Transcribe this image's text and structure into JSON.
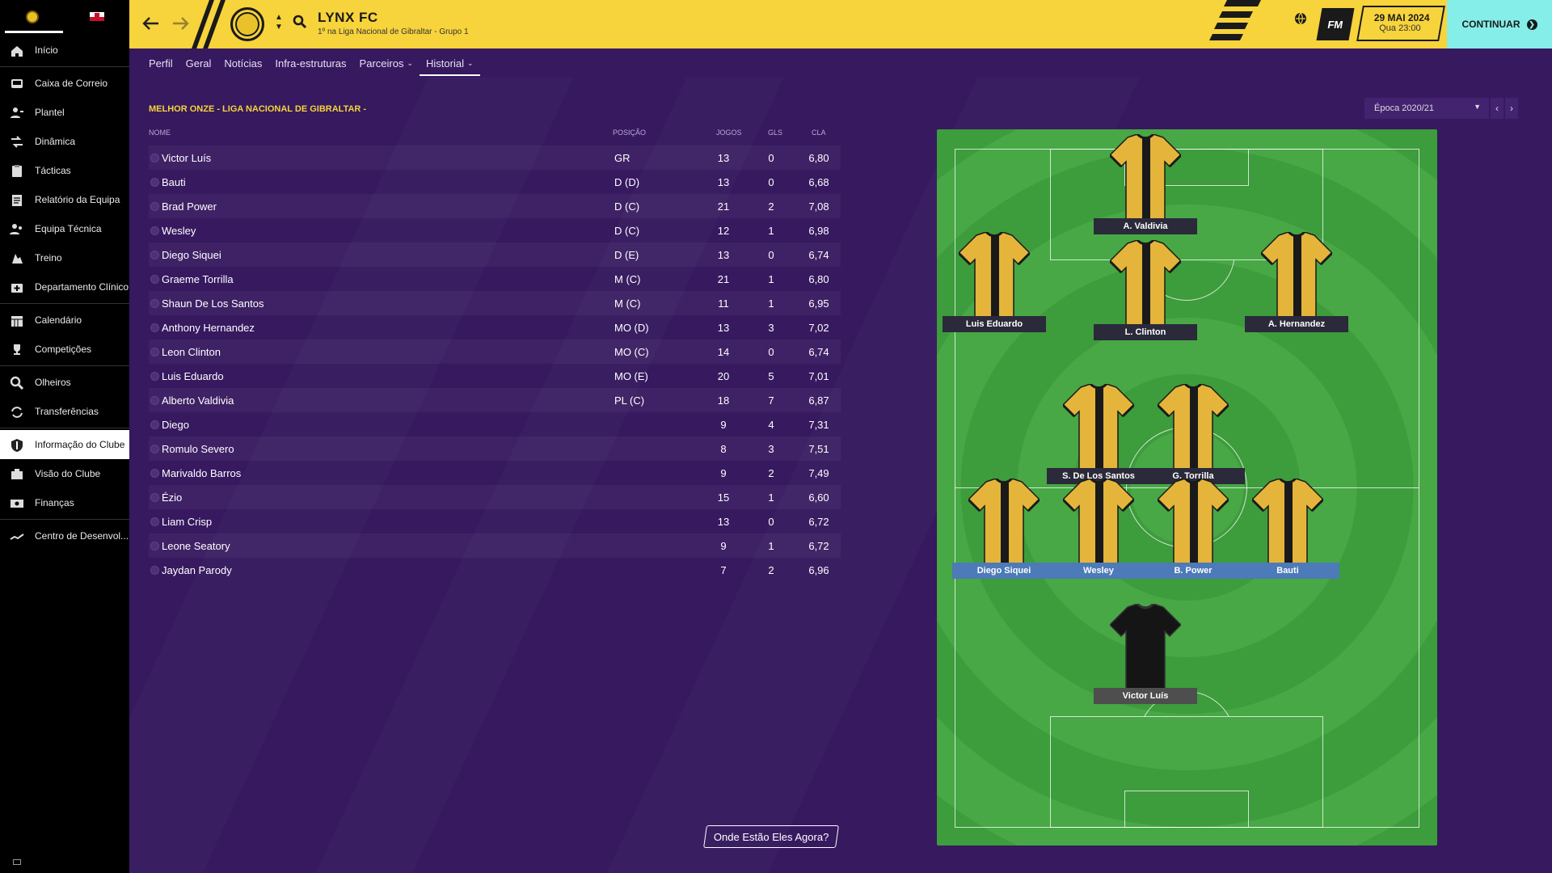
{
  "sidebar": {
    "items": [
      {
        "label": "Início",
        "icon": "home-icon",
        "group": 0
      },
      {
        "label": "Caixa de Correio",
        "icon": "inbox-icon",
        "group": 1
      },
      {
        "label": "Plantel",
        "icon": "squad-icon",
        "group": 1
      },
      {
        "label": "Dinâmica",
        "icon": "dynamics-icon",
        "group": 1
      },
      {
        "label": "Tácticas",
        "icon": "tactics-clipboard-icon",
        "group": 1
      },
      {
        "label": "Relatório da Equipa",
        "icon": "report-icon",
        "group": 1
      },
      {
        "label": "Equipa Técnica",
        "icon": "staff-icon",
        "group": 1
      },
      {
        "label": "Treino",
        "icon": "training-icon",
        "group": 1
      },
      {
        "label": "Departamento Clínico",
        "icon": "medical-icon",
        "group": 1
      },
      {
        "label": "Calendário",
        "icon": "calendar-icon",
        "group": 2
      },
      {
        "label": "Competições",
        "icon": "trophy-icon",
        "group": 2
      },
      {
        "label": "Olheiros",
        "icon": "scouting-icon",
        "group": 3
      },
      {
        "label": "Transferências",
        "icon": "transfers-icon",
        "group": 3
      },
      {
        "label": "Informação do Clube",
        "icon": "club-shield-icon",
        "group": 4,
        "active": true
      },
      {
        "label": "Visão do Clube",
        "icon": "vision-icon",
        "group": 4
      },
      {
        "label": "Finanças",
        "icon": "finances-icon",
        "group": 4
      },
      {
        "label": "Centro de Desenvol...",
        "icon": "development-icon",
        "group": 5
      }
    ]
  },
  "header": {
    "club_name": "LYNX FC",
    "club_subtitle": "1º na Liga Nacional de Gibraltar - Grupo 1",
    "fm_label": "FM",
    "date": "29 MAI 2024",
    "day_time": "Qua 23:00",
    "continue_label": "CONTINUAR"
  },
  "tabs": [
    {
      "label": "Perfil",
      "has_dropdown": false
    },
    {
      "label": "Geral",
      "has_dropdown": false
    },
    {
      "label": "Notícias",
      "has_dropdown": false
    },
    {
      "label": "Infra-estruturas",
      "has_dropdown": false
    },
    {
      "label": "Parceiros",
      "has_dropdown": true
    },
    {
      "label": "Historial",
      "has_dropdown": true,
      "active": true
    }
  ],
  "table": {
    "title": "MELHOR ONZE - LIGA NACIONAL DE GIBRALTAR -",
    "columns": {
      "name": "NOME",
      "position": "POSIÇÃO",
      "games": "JOGOS",
      "goals": "GLS",
      "rating": "CLA"
    },
    "rows": [
      {
        "name": "Victor Luís",
        "position": "GR",
        "games": "13",
        "goals": "0",
        "rating": "6,80"
      },
      {
        "name": "Bauti",
        "position": "D (D)",
        "games": "13",
        "goals": "0",
        "rating": "6,68"
      },
      {
        "name": "Brad Power",
        "position": "D (C)",
        "games": "21",
        "goals": "2",
        "rating": "7,08"
      },
      {
        "name": "Wesley",
        "position": "D (C)",
        "games": "12",
        "goals": "1",
        "rating": "6,98"
      },
      {
        "name": "Diego Siquei",
        "position": "D (E)",
        "games": "13",
        "goals": "0",
        "rating": "6,74"
      },
      {
        "name": "Graeme Torrilla",
        "position": "M (C)",
        "games": "21",
        "goals": "1",
        "rating": "6,80"
      },
      {
        "name": "Shaun De Los Santos",
        "position": "M (C)",
        "games": "11",
        "goals": "1",
        "rating": "6,95"
      },
      {
        "name": "Anthony Hernandez",
        "position": "MO (D)",
        "games": "13",
        "goals": "3",
        "rating": "7,02"
      },
      {
        "name": "Leon Clinton",
        "position": "MO (C)",
        "games": "14",
        "goals": "0",
        "rating": "6,74"
      },
      {
        "name": "Luis Eduardo",
        "position": "MO (E)",
        "games": "20",
        "goals": "5",
        "rating": "7,01"
      },
      {
        "name": "Alberto Valdivia",
        "position": "PL (C)",
        "games": "18",
        "goals": "7",
        "rating": "6,87"
      },
      {
        "name": "Diego",
        "position": "",
        "games": "9",
        "goals": "4",
        "rating": "7,31"
      },
      {
        "name": "Romulo Severo",
        "position": "",
        "games": "8",
        "goals": "3",
        "rating": "7,51"
      },
      {
        "name": "Marivaldo Barros",
        "position": "",
        "games": "9",
        "goals": "2",
        "rating": "7,49"
      },
      {
        "name": "Ézio",
        "position": "",
        "games": "15",
        "goals": "1",
        "rating": "6,60"
      },
      {
        "name": "Liam Crisp",
        "position": "",
        "games": "13",
        "goals": "0",
        "rating": "6,72"
      },
      {
        "name": "Leone Seatory",
        "position": "",
        "games": "9",
        "goals": "1",
        "rating": "6,72"
      },
      {
        "name": "Jaydan Parody",
        "position": "",
        "games": "7",
        "goals": "2",
        "rating": "6,96"
      }
    ]
  },
  "season_selector": {
    "value": "Época 2020/21"
  },
  "formation": {
    "players": [
      {
        "label": "A. Valdivia",
        "kit": "outfield",
        "line": "attack"
      },
      {
        "label": "Luis Eduardo",
        "kit": "outfield",
        "line": "attack"
      },
      {
        "label": "L. Clinton",
        "kit": "outfield",
        "line": "attack"
      },
      {
        "label": "A. Hernandez",
        "kit": "outfield",
        "line": "attack"
      },
      {
        "label": "S. De Los Santos",
        "kit": "outfield",
        "line": "midfield"
      },
      {
        "label": "G. Torrilla",
        "kit": "outfield",
        "line": "midfield"
      },
      {
        "label": "Diego Siquei",
        "kit": "outfield",
        "line": "defence"
      },
      {
        "label": "Wesley",
        "kit": "outfield",
        "line": "defence"
      },
      {
        "label": "B. Power",
        "kit": "outfield",
        "line": "defence"
      },
      {
        "label": "Bauti",
        "kit": "outfield",
        "line": "defence"
      },
      {
        "label": "Victor Luís",
        "kit": "goalkeeper",
        "line": "goalkeeper"
      }
    ]
  },
  "footer_button": {
    "label": "Onde Estão Eles Agora?"
  },
  "colors": {
    "accent": "#f7d33c",
    "background": "#36195f",
    "continue": "#86eee8",
    "pitch": "#47a845"
  }
}
